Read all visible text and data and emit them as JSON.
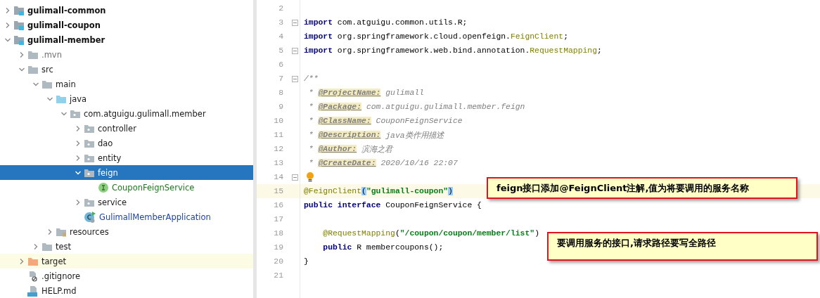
{
  "project_tree": [
    {
      "label": "gulimall-common",
      "kind": "module",
      "expanded": false,
      "selected": false
    },
    {
      "label": "gulimall-coupon",
      "kind": "module",
      "expanded": false,
      "selected": false
    },
    {
      "label": "gulimall-member",
      "kind": "module",
      "expanded": true,
      "selected": false,
      "children": [
        {
          "label": ".mvn",
          "kind": "hidden-folder",
          "expanded": false,
          "selected": false
        },
        {
          "label": "src",
          "kind": "folder",
          "expanded": true,
          "selected": false,
          "children": [
            {
              "label": "main",
              "kind": "folder",
              "expanded": true,
              "selected": false,
              "children": [
                {
                  "label": "java",
                  "kind": "source-folder",
                  "expanded": true,
                  "selected": false,
                  "children": [
                    {
                      "label": "com.atguigu.gulimall.member",
                      "kind": "package",
                      "expanded": true,
                      "selected": false,
                      "children": [
                        {
                          "label": "controller",
                          "kind": "package",
                          "expanded": false,
                          "selected": false
                        },
                        {
                          "label": "dao",
                          "kind": "package",
                          "expanded": false,
                          "selected": false
                        },
                        {
                          "label": "entity",
                          "kind": "package",
                          "expanded": false,
                          "selected": false
                        },
                        {
                          "label": "feign",
                          "kind": "package",
                          "expanded": true,
                          "selected": true,
                          "children": [
                            {
                              "label": "CouponFeignService",
                              "kind": "interface",
                              "selected": false
                            }
                          ]
                        },
                        {
                          "label": "service",
                          "kind": "package",
                          "expanded": false,
                          "selected": false
                        },
                        {
                          "label": "GulimallMemberApplication",
                          "kind": "app-class",
                          "selected": false
                        }
                      ]
                    }
                  ]
                },
                {
                  "label": "resources",
                  "kind": "resources",
                  "expanded": false,
                  "selected": false
                }
              ]
            },
            {
              "label": "test",
              "kind": "folder",
              "expanded": false,
              "selected": false
            }
          ]
        },
        {
          "label": "target",
          "kind": "excluded-folder",
          "expanded": false,
          "selected": false
        },
        {
          "label": ".gitignore",
          "kind": "ignore-file",
          "selected": false
        },
        {
          "label": "HELP.md",
          "kind": "markdown-file",
          "selected": false
        }
      ]
    }
  ],
  "editor": {
    "lines": [
      {
        "number": "2",
        "current": false,
        "fold": false,
        "bulb": false
      },
      {
        "number": "3",
        "current": false,
        "fold": true,
        "bulb": false,
        "tokens": [
          {
            "text": "import",
            "kind": "keyword"
          },
          {
            "text": " com.atguigu.common.utils.R;",
            "kind": "plain"
          }
        ]
      },
      {
        "number": "4",
        "current": false,
        "fold": false,
        "bulb": false,
        "tokens": [
          {
            "text": "import",
            "kind": "keyword"
          },
          {
            "text": " org.springframework.cloud.openfeign.",
            "kind": "plain"
          },
          {
            "text": "FeignClient",
            "kind": "annotation"
          },
          {
            "text": ";",
            "kind": "plain"
          }
        ]
      },
      {
        "number": "5",
        "current": false,
        "fold": true,
        "bulb": false,
        "tokens": [
          {
            "text": "import",
            "kind": "keyword"
          },
          {
            "text": " org.springframework.web.bind.annotation.",
            "kind": "plain"
          },
          {
            "text": "RequestMapping",
            "kind": "annotation"
          },
          {
            "text": ";",
            "kind": "plain"
          }
        ]
      },
      {
        "number": "6",
        "current": false,
        "fold": false,
        "bulb": false
      },
      {
        "number": "7",
        "current": false,
        "fold": true,
        "bulb": false,
        "tokens": [
          {
            "text": "/**",
            "kind": "comment"
          }
        ]
      },
      {
        "number": "8",
        "current": false,
        "fold": false,
        "bulb": false,
        "tokens": [
          {
            "text": " * ",
            "kind": "comment"
          },
          {
            "text": "@ProjectName:",
            "kind": "doc-tag"
          },
          {
            "text": " gulimall",
            "kind": "doc-value"
          }
        ]
      },
      {
        "number": "9",
        "current": false,
        "fold": false,
        "bulb": false,
        "tokens": [
          {
            "text": " * ",
            "kind": "comment"
          },
          {
            "text": "@Package:",
            "kind": "doc-tag"
          },
          {
            "text": " com.atguigu.gulimall.member.feign",
            "kind": "doc-value"
          }
        ]
      },
      {
        "number": "10",
        "current": false,
        "fold": false,
        "bulb": false,
        "tokens": [
          {
            "text": " * ",
            "kind": "comment"
          },
          {
            "text": "@ClassName:",
            "kind": "doc-tag"
          },
          {
            "text": " CouponFeignService",
            "kind": "doc-value"
          }
        ]
      },
      {
        "number": "11",
        "current": false,
        "fold": false,
        "bulb": false,
        "tokens": [
          {
            "text": " * ",
            "kind": "comment"
          },
          {
            "text": "@Description:",
            "kind": "doc-tag"
          },
          {
            "text": " java类作用描述",
            "kind": "doc-value"
          }
        ]
      },
      {
        "number": "12",
        "current": false,
        "fold": false,
        "bulb": false,
        "tokens": [
          {
            "text": " * ",
            "kind": "comment"
          },
          {
            "text": "@Author:",
            "kind": "doc-tag"
          },
          {
            "text": " 滨海之君",
            "kind": "doc-value"
          }
        ]
      },
      {
        "number": "13",
        "current": false,
        "fold": false,
        "bulb": false,
        "tokens": [
          {
            "text": " * ",
            "kind": "comment"
          },
          {
            "text": "@CreateDate:",
            "kind": "doc-tag"
          },
          {
            "text": " 2020/10/16 22:07",
            "kind": "doc-value"
          }
        ]
      },
      {
        "number": "14",
        "current": false,
        "fold": true,
        "bulb": true
      },
      {
        "number": "15",
        "current": true,
        "fold": false,
        "bulb": false,
        "tokens": [
          {
            "text": "@FeignClient",
            "kind": "annotation"
          },
          {
            "text": "(",
            "kind": "brace-match"
          },
          {
            "text": "\"gulimall-coupon\"",
            "kind": "string"
          },
          {
            "text": ")",
            "kind": "brace-match"
          }
        ]
      },
      {
        "number": "16",
        "current": false,
        "fold": false,
        "bulb": false,
        "tokens": [
          {
            "text": "public interface",
            "kind": "keyword"
          },
          {
            "text": " CouponFeignService {",
            "kind": "plain"
          }
        ]
      },
      {
        "number": "17",
        "current": false,
        "fold": false,
        "bulb": false
      },
      {
        "number": "18",
        "current": false,
        "fold": false,
        "bulb": false,
        "tokens": [
          {
            "text": "    @RequestMapping",
            "kind": "annotation"
          },
          {
            "text": "(",
            "kind": "plain"
          },
          {
            "text": "\"/coupon/coupon/member/list\"",
            "kind": "string"
          },
          {
            "text": ")",
            "kind": "plain"
          }
        ]
      },
      {
        "number": "19",
        "current": false,
        "fold": false,
        "bulb": false,
        "tokens": [
          {
            "text": "    public",
            "kind": "keyword"
          },
          {
            "text": " R membercoupons();",
            "kind": "plain"
          }
        ]
      },
      {
        "number": "20",
        "current": false,
        "fold": false,
        "bulb": false,
        "tokens": [
          {
            "text": "}",
            "kind": "plain"
          }
        ]
      },
      {
        "number": "21",
        "current": false,
        "fold": false,
        "bulb": false
      }
    ]
  },
  "callouts": [
    {
      "text": "feign接口添加@FeignClient注解,值为将要调用的服务名称",
      "kind": "short"
    },
    {
      "text": "要调用服务的接口,请求路径要写全路径",
      "kind": "tall"
    }
  ]
}
